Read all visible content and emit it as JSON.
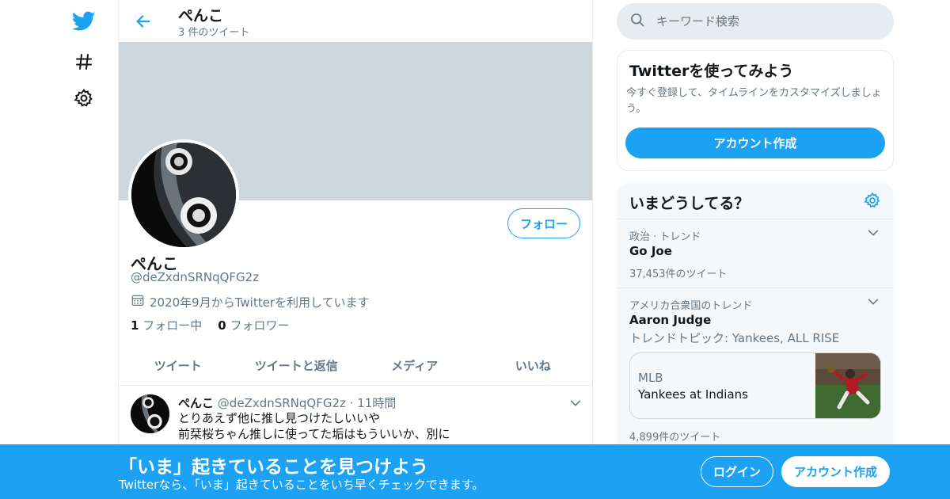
{
  "colors": {
    "accent": "#1da1f2",
    "muted": "#657786",
    "banner": "#ccd6dd",
    "border": "#e6ecf0"
  },
  "nav": {
    "items": [
      {
        "icon": "twitter-bird-icon"
      },
      {
        "icon": "hashtag-icon"
      },
      {
        "icon": "gear-icon"
      }
    ]
  },
  "header": {
    "name": "ぺんこ",
    "tweet_count": "3 件のツイート"
  },
  "profile": {
    "name": "ぺんこ",
    "handle": "@deZxdnSRNqQFG2z",
    "joined": "2020年9月からTwitterを利用しています",
    "following_count": "1",
    "following_label": "フォロー中",
    "followers_count": "0",
    "followers_label": "フォロワー",
    "follow_button": "フォロー"
  },
  "tabs": [
    {
      "label": "ツイート"
    },
    {
      "label": "ツイートと返信"
    },
    {
      "label": "メディア"
    },
    {
      "label": "いいね"
    }
  ],
  "tweet": {
    "name": "ぺんこ",
    "handle": "@deZxdnSRNqQFG2z",
    "time": "· 11時間",
    "line1": "とりあえず他に推し見つけたしいいや",
    "line2": "前栞桜ちゃん推しに使ってた垢はもういいか、別に"
  },
  "search": {
    "placeholder": "キーワード検索"
  },
  "signup_card": {
    "title": "Twitterを使ってみよう",
    "desc": "今すぐ登録して、タイムラインをカスタマイズしましょう。",
    "button": "アカウント作成"
  },
  "trends": {
    "title": "いまどうしてる？",
    "items": [
      {
        "meta": "政治 · トレンド",
        "name": "Go Joe",
        "count": "37,453件のツイート"
      },
      {
        "meta": "アメリカ合衆国のトレンド",
        "name": "Aaron Judge",
        "topic": "トレンドトピック: Yankees, ALL RISE"
      }
    ],
    "event": {
      "source": "MLB",
      "title": "Yankees at Indians"
    },
    "bottom_count": "4,899件のツイート"
  },
  "bottom_bar": {
    "title": "「いま」起きていることを見つけよう",
    "subtitle": "Twitterなら、「いま」起きていることをいち早くチェックできます。",
    "login": "ログイン",
    "signup": "アカウント作成"
  }
}
